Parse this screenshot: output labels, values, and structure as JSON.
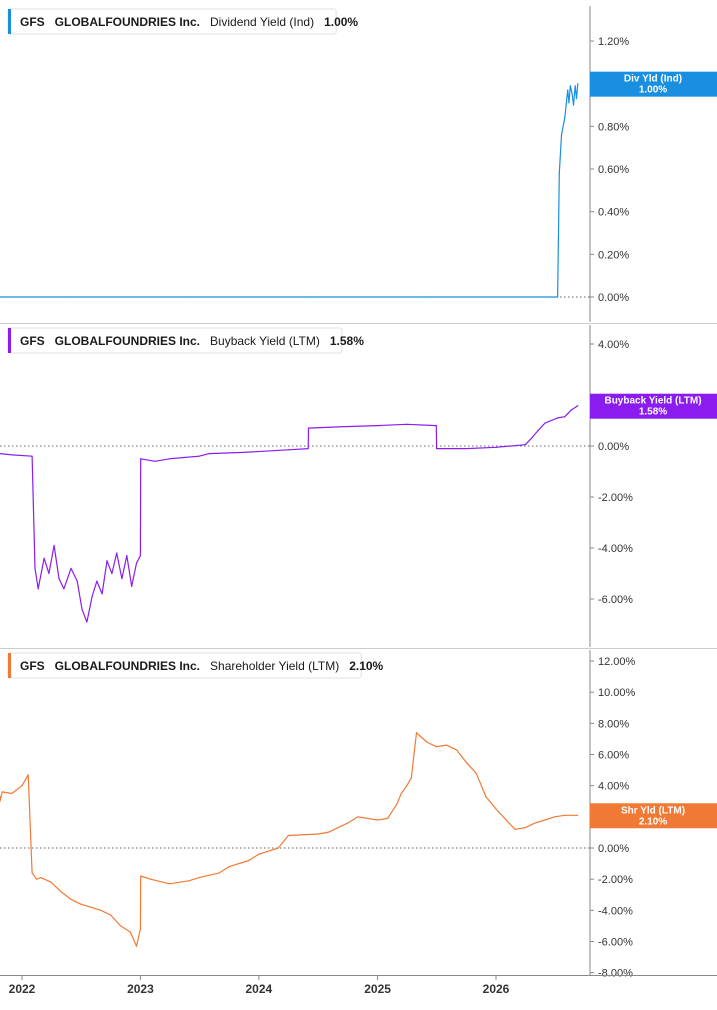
{
  "chart_data": [
    {
      "type": "line",
      "ticker": "GFS",
      "company": "GLOBALFOUNDRIES Inc.",
      "metric": "Dividend Yield (Ind)",
      "value_label": "1.00%",
      "badge_label": "Div Yld (Ind)",
      "badge_value": "1.00%",
      "color": "#1a8fe0",
      "unit": "%",
      "ylim": [
        0,
        1.3
      ],
      "yticks": [
        0.0,
        0.2,
        0.4,
        0.6,
        0.8,
        1.0,
        1.2
      ],
      "ytick_labels": [
        "0.00%",
        "0.20%",
        "0.40%",
        "0.60%",
        "0.80%",
        "1.00%",
        "1.20%"
      ],
      "zero_line": true,
      "x": [
        "2021-09-01",
        "2022-06-01",
        "2023-06-01",
        "2024-06-01",
        "2025-06-01",
        "2026-06-01",
        "2026-07-10",
        "2026-07-15",
        "2026-07-22",
        "2026-08-01",
        "2026-08-10",
        "2026-08-14",
        "2026-08-18",
        "2026-08-24",
        "2026-08-28",
        "2026-09-02",
        "2026-09-06",
        "2026-09-10"
      ],
      "values": [
        0,
        0,
        0,
        0,
        0,
        0,
        0,
        0.58,
        0.76,
        0.84,
        0.97,
        0.91,
        0.99,
        0.95,
        0.9,
        0.99,
        0.93,
        1.0
      ]
    },
    {
      "type": "line",
      "ticker": "GFS",
      "company": "GLOBALFOUNDRIES Inc.",
      "metric": "Buyback Yield (LTM)",
      "value_label": "1.58%",
      "badge_label": "Buyback Yield (LTM)",
      "badge_value": "1.58%",
      "color": "#8a1cf0",
      "unit": "%",
      "ylim": [
        -7.0,
        4.5
      ],
      "yticks": [
        -6.0,
        -4.0,
        -2.0,
        0.0,
        4.0
      ],
      "ytick_labels": [
        "-6.00%",
        "-4.00%",
        "-2.00%",
        "0.00%",
        "4.00%"
      ],
      "zero_line": true,
      "x": [
        "2021-09-01",
        "2021-10-15",
        "2021-12-01",
        "2022-02-01",
        "2022-02-10",
        "2022-02-20",
        "2022-03-10",
        "2022-03-25",
        "2022-04-10",
        "2022-04-25",
        "2022-05-10",
        "2022-06-01",
        "2022-06-20",
        "2022-07-05",
        "2022-07-20",
        "2022-08-05",
        "2022-08-20",
        "2022-09-05",
        "2022-09-20",
        "2022-10-05",
        "2022-10-20",
        "2022-11-05",
        "2022-11-20",
        "2022-12-05",
        "2022-12-20",
        "2023-01-01",
        "2023-01-02",
        "2023-02-15",
        "2023-04-01",
        "2023-05-15",
        "2023-07-01",
        "2023-08-01",
        "2023-11-15",
        "2024-04-01",
        "2024-06-01",
        "2024-06-02",
        "2024-09-01",
        "2025-01-01",
        "2025-04-01",
        "2025-07-01",
        "2025-07-02",
        "2025-10-01",
        "2026-01-01",
        "2026-04-01",
        "2026-04-20",
        "2026-05-10",
        "2026-06-01",
        "2026-06-20",
        "2026-07-10",
        "2026-08-01",
        "2026-08-20",
        "2026-09-10"
      ],
      "values": [
        -0.3,
        -0.3,
        -0.35,
        -0.4,
        -4.8,
        -5.6,
        -4.4,
        -5.0,
        -3.9,
        -5.2,
        -5.6,
        -4.8,
        -5.3,
        -6.4,
        -6.9,
        -5.9,
        -5.3,
        -5.8,
        -4.5,
        -5.0,
        -4.2,
        -5.2,
        -4.3,
        -5.5,
        -4.6,
        -4.3,
        -0.5,
        -0.6,
        -0.5,
        -0.45,
        -0.4,
        -0.3,
        -0.25,
        -0.15,
        -0.1,
        0.7,
        0.75,
        0.8,
        0.85,
        0.8,
        -0.1,
        -0.1,
        -0.05,
        0.05,
        0.3,
        0.6,
        0.9,
        1.0,
        1.1,
        1.15,
        1.4,
        1.58
      ]
    },
    {
      "type": "line",
      "ticker": "GFS",
      "company": "GLOBALFOUNDRIES Inc.",
      "metric": "Shareholder Yield (LTM)",
      "value_label": "2.10%",
      "badge_label": "Shr Yld (LTM)",
      "badge_value": "2.10%",
      "color": "#f07a35",
      "unit": "%",
      "ylim": [
        -8.0,
        12.0
      ],
      "yticks": [
        -8.0,
        -6.0,
        -4.0,
        -2.0,
        0.0,
        2.0,
        4.0,
        6.0,
        8.0,
        10.0,
        12.0
      ],
      "ytick_labels": [
        "-8.00%",
        "-6.00%",
        "-4.00%",
        "-2.00%",
        "0.00%",
        "2.00%",
        "4.00%",
        "6.00%",
        "8.00%",
        "10.00%",
        "12.00%"
      ],
      "zero_line": true,
      "x": [
        "2021-09-01",
        "2021-10-01",
        "2021-11-01",
        "2021-12-01",
        "2022-01-01",
        "2022-01-20",
        "2022-02-01",
        "2022-02-15",
        "2022-03-01",
        "2022-04-01",
        "2022-05-01",
        "2022-06-01",
        "2022-07-01",
        "2022-08-01",
        "2022-09-01",
        "2022-10-01",
        "2022-11-01",
        "2022-12-01",
        "2022-12-20",
        "2023-01-01",
        "2023-01-02",
        "2023-02-01",
        "2023-04-01",
        "2023-06-01",
        "2023-07-01",
        "2023-09-01",
        "2023-10-01",
        "2023-12-01",
        "2024-01-01",
        "2024-03-01",
        "2024-04-01",
        "2024-07-01",
        "2024-08-01",
        "2024-10-01",
        "2024-11-01",
        "2025-01-01",
        "2025-02-01",
        "2025-03-01",
        "2025-03-15",
        "2025-04-01",
        "2025-04-15",
        "2025-05-01",
        "2025-06-01",
        "2025-07-01",
        "2025-08-01",
        "2025-09-01",
        "2025-10-01",
        "2025-11-01",
        "2025-12-01",
        "2026-01-01",
        "2026-02-01",
        "2026-03-01",
        "2026-04-01",
        "2026-05-01",
        "2026-06-01",
        "2026-07-01",
        "2026-08-01",
        "2026-09-10"
      ],
      "values": [
        3.3,
        3.0,
        3.6,
        3.5,
        4.0,
        4.7,
        -1.6,
        -2.0,
        -1.9,
        -2.2,
        -2.8,
        -3.3,
        -3.6,
        -3.8,
        -4.0,
        -4.3,
        -5.0,
        -5.4,
        -6.3,
        -5.2,
        -1.8,
        -2.0,
        -2.3,
        -2.1,
        -1.9,
        -1.6,
        -1.2,
        -0.8,
        -0.4,
        0.0,
        0.8,
        0.9,
        1.0,
        1.6,
        2.0,
        1.8,
        1.9,
        2.8,
        3.5,
        4.0,
        4.5,
        7.4,
        6.8,
        6.5,
        6.6,
        6.3,
        5.5,
        4.8,
        3.3,
        2.5,
        1.8,
        1.2,
        1.3,
        1.6,
        1.8,
        2.0,
        2.1,
        2.1
      ]
    }
  ],
  "x_axis": {
    "ticks": [
      {
        "date": "2022-01-01",
        "label": "2022"
      },
      {
        "date": "2023-01-01",
        "label": "2023"
      },
      {
        "date": "2024-01-01",
        "label": "2024"
      },
      {
        "date": "2025-01-01",
        "label": "2025"
      },
      {
        "date": "2026-01-01",
        "label": "2026"
      }
    ],
    "range": [
      "2021-11-15",
      "2026-09-30"
    ]
  },
  "colors": {
    "grid_separator": "#cccccc",
    "zero_line": "#666666",
    "axis_text": "#333333"
  }
}
